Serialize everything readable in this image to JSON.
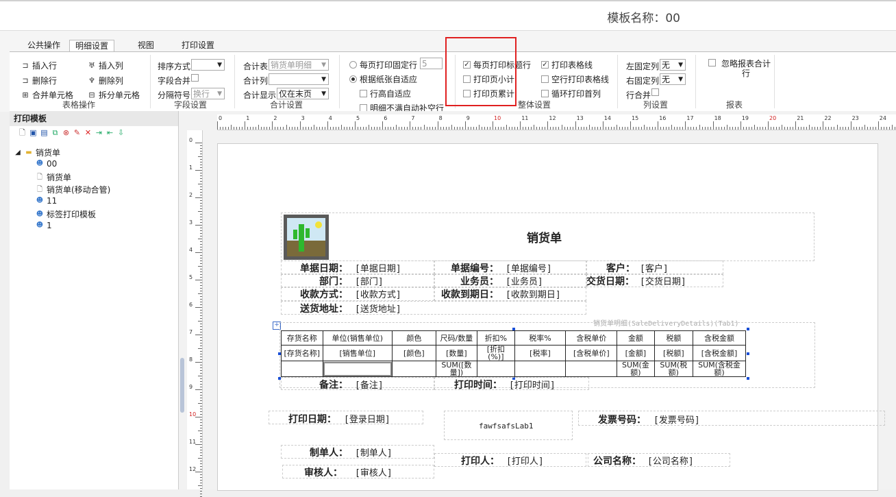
{
  "header": {
    "template_name": "模板名称：00"
  },
  "tabs": [
    {
      "label": "公共操作",
      "active": false
    },
    {
      "label": "明细设置",
      "active": true
    },
    {
      "label": "视图",
      "active": false
    },
    {
      "label": "打印设置",
      "active": false
    }
  ],
  "table_ops": {
    "insert_row": "插入行",
    "delete_row": "删除行",
    "merge_cells": "合并单元格",
    "insert_col": "插入列",
    "delete_col": "删除列",
    "split_cells": "拆分单元格",
    "group": "表格操作"
  },
  "field_settings": {
    "sort_label": "排序方式",
    "sort_value": "",
    "merge_label": "字段合并",
    "separator_label": "分隔符号",
    "separator_value": "换行",
    "group": "字段设置"
  },
  "total_settings": {
    "table_label": "合计表",
    "table_value": "销货单明细",
    "col_label": "合计列",
    "col_value": "",
    "display_label": "合计显示",
    "display_value": "仅在末页",
    "group": "合计设置"
  },
  "page_rows": {
    "fixed_label": "每页打印固定行",
    "fixed_value": "5",
    "adapt_label": "根据纸张自适应",
    "row_height_label": "行高自适应",
    "fill_empty_label": "明细不满自动补空行"
  },
  "overall": {
    "print_header_label": "每页打印标题行",
    "page_subtotal_label": "打印页小计",
    "page_cumulative_label": "打印页累计",
    "print_gridlines_label": "打印表格线",
    "empty_row_grid_label": "空行打印表格线",
    "cycle_first_col_label": "循环打印首列",
    "group": "整体设置"
  },
  "column_settings": {
    "left_fixed_label": "左固定列",
    "left_fixed_value": "无",
    "right_fixed_label": "右固定列",
    "right_fixed_value": "无",
    "row_merge_label": "行合并",
    "group": "列设置"
  },
  "report": {
    "ignore_total_label": "忽略报表合计行",
    "group": "报表"
  },
  "left_panel": {
    "title": "打印模板",
    "tree": [
      {
        "label": "销货单",
        "type": "folder"
      },
      {
        "label": "00",
        "type": "selected"
      },
      {
        "label": "销货单",
        "type": "doc"
      },
      {
        "label": "销货单(移动合管)",
        "type": "doc"
      },
      {
        "label": "11",
        "type": "user"
      },
      {
        "label": "标签打印模板",
        "type": "user"
      },
      {
        "label": "1",
        "type": "user"
      }
    ]
  },
  "ruler": {
    "h_ticks": [
      "0",
      "1",
      "2",
      "3",
      "4",
      "5",
      "6",
      "7",
      "8",
      "9",
      "10",
      "11",
      "12",
      "13",
      "14",
      "15",
      "16",
      "17",
      "18",
      "19",
      "20",
      "21",
      "22",
      "23",
      "24"
    ],
    "v_ticks": [
      "0",
      "1",
      "2",
      "3",
      "4",
      "5",
      "6",
      "7",
      "8",
      "9",
      "10",
      "11",
      "12"
    ]
  },
  "document": {
    "title": "销货单",
    "fields": [
      {
        "label": "单据日期：",
        "value": "[单据日期]"
      },
      {
        "label": "单据编号：",
        "value": "[单据编号]"
      },
      {
        "label": "客户：",
        "value": "[客户]"
      },
      {
        "label": "部门：",
        "value": "[部门]"
      },
      {
        "label": "业务员：",
        "value": "[业务员]"
      },
      {
        "label": "交货日期：",
        "value": "[交货日期]"
      },
      {
        "label": "收款方式：",
        "value": "[收款方式]"
      },
      {
        "label": "收款到期日：",
        "value": "[收款到期日]"
      },
      {
        "label": "送货地址：",
        "value": "[送货地址]"
      }
    ],
    "detail_caption": "销货单明细(SaleDeliveryDetails)(Tab1)",
    "detail_headers": [
      "存货名称",
      "单位(销售单位)",
      "颜色",
      "尺码/数量",
      "折扣%",
      "税率%",
      "含税单价",
      "金额",
      "税额",
      "含税金额"
    ],
    "detail_row": [
      "[存货名称]",
      "[销售单位]",
      "[颜色]",
      "[数量]",
      "[折扣(%)]",
      "[税率]",
      "[含税单价]",
      "[金额]",
      "[税额]",
      "[含税金额]"
    ],
    "sum_row": [
      "",
      "",
      "",
      "SUM([数量])",
      "",
      "",
      "",
      "SUM(金额)",
      "SUM(税额)",
      "SUM(含税金额)"
    ],
    "remark_label": "备注：",
    "remark_value": "[备注]",
    "print_time_label": "打印时间：",
    "print_time_value": "[打印时间]",
    "print_date_label": "打印日期：",
    "print_date_value": "[登录日期]",
    "free_label": "fawfsafsLab1",
    "invoice_label": "发票号码：",
    "invoice_value": "[发票号码]",
    "maker_label": "制单人：",
    "maker_value": "[制单人]",
    "printer_label": "打印人：",
    "printer_value": "[打印人]",
    "company_label": "公司名称：",
    "company_value": "[公司名称]",
    "auditor_label": "审核人：",
    "auditor_value": "[审核人]"
  }
}
